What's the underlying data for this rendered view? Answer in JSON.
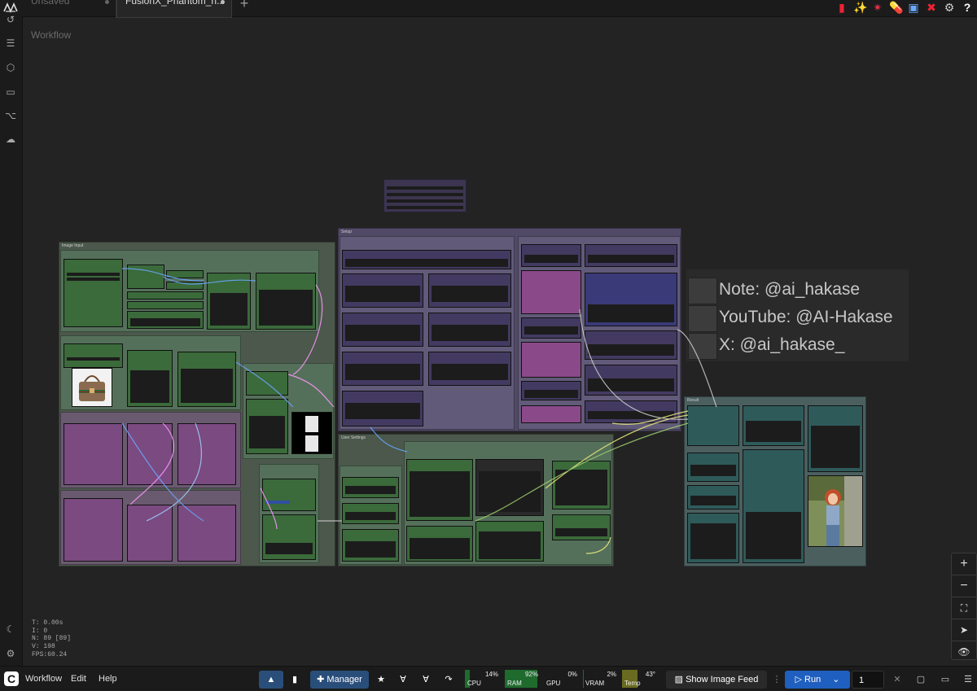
{
  "tabs": [
    {
      "label": "Unsaved Workflow"
    },
    {
      "label": "FusionX_Phantom_n..."
    }
  ],
  "new_tab_label": "+",
  "top_icons": [
    "bug-icon",
    "sparkle-icon",
    "spark-icon",
    "pill-icon",
    "screen-icon",
    "close-x-icon",
    "gear-icon",
    "help-icon"
  ],
  "top_icon_glyphs": [
    "▮",
    "✨",
    "✴",
    "💊",
    "▣",
    "✖",
    "⚙",
    "?"
  ],
  "left_icons": [
    "history-icon",
    "queue-icon",
    "model-library-icon",
    "workflows-icon",
    "node-map-icon",
    "templates-icon"
  ],
  "left_icons_bottom": [
    "theme-moon-icon",
    "settings-gear-icon"
  ],
  "stats": [
    "T: 0.00s",
    "I: 0",
    "N: 89 [89]",
    "V: 198",
    "FPS:60.24"
  ],
  "note": {
    "lines": [
      "Note: @ai_hakase",
      "YouTube: @AI-Hakase",
      "X: @ai_hakase_"
    ]
  },
  "groups": {
    "image_input": "Image Input",
    "setup": "Setup",
    "user_settings": "User Settings",
    "result": "Result"
  },
  "menu": {
    "workflow": "Workflow",
    "edit": "Edit",
    "help": "Help"
  },
  "manager_label": "Manager",
  "monitors": [
    {
      "label": "CPU",
      "value": "14%",
      "fraction": 0.14
    },
    {
      "label": "RAM",
      "value": "92%",
      "fraction": 0.92
    },
    {
      "label": "GPU",
      "value": "0%",
      "fraction": 0
    },
    {
      "label": "VRAM",
      "value": "2%",
      "fraction": 0.02
    },
    {
      "label": "Temp",
      "value": "43°",
      "fraction": 0.43
    }
  ],
  "show_image_feed": "Show Image Feed",
  "run_label": "Run",
  "batch_count": "1",
  "zoom_controls": [
    "+",
    "−",
    "⛶",
    "➤",
    "👁"
  ],
  "colors": {
    "green_node": "#3b5a35",
    "purple_node": "#5b3b6b",
    "teal_node": "#2f5a5a",
    "run_button": "#1f5fbf",
    "manager_button": "#2a4e7a"
  }
}
